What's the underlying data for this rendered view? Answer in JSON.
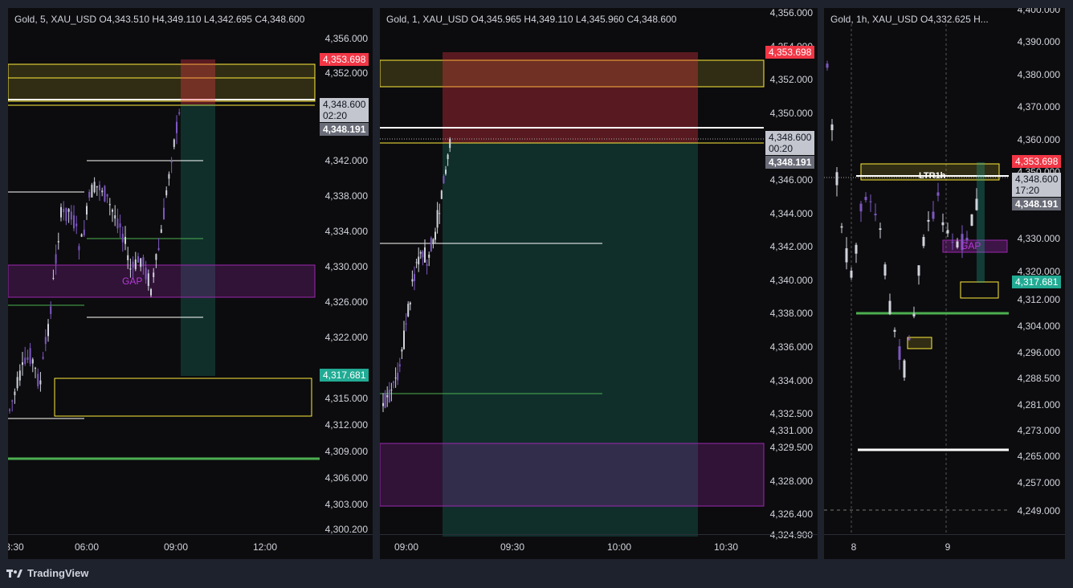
{
  "panes": [
    {
      "legend": "Gold, 5, XAU_USD  O4,343.510  H4,349.110  L4,342.695  C4,348.600",
      "price_ticks": [
        "4,356.000",
        "4,352.000",
        "4,342.000",
        "4,338.000",
        "4,334.000",
        "4,330.000",
        "4,326.000",
        "4,322.000",
        "4,315.000",
        "4,312.000",
        "4,309.000",
        "4,306.000",
        "4,303.000",
        "4,300.200"
      ],
      "time_ticks": [
        "3:30",
        "06:00",
        "09:00",
        "12:00"
      ],
      "tags": {
        "red": "4,353.698",
        "last": "4,348.600",
        "countdown": "02:20",
        "ma": "4,348.191",
        "teal": "4,317.681"
      },
      "gap_label": "GAP"
    },
    {
      "legend": "Gold, 1, XAU_USD  O4,345.965  H4,349.110  L4,345.960  C4,348.600",
      "price_ticks": [
        "4,356.000",
        "4,354.000",
        "4,352.000",
        "4,350.000",
        "4,346.000",
        "4,344.000",
        "4,342.000",
        "4,340.000",
        "4,338.000",
        "4,336.000",
        "4,334.000",
        "4,332.500",
        "4,331.000",
        "4,329.500",
        "4,328.000",
        "4,326.400",
        "4,324.900"
      ],
      "time_ticks": [
        "09:00",
        "09:30",
        "10:00",
        "10:30"
      ],
      "tags": {
        "red": "4,353.698",
        "last": "4,348.600",
        "countdown": "00:20",
        "ma": "4,348.191"
      }
    },
    {
      "legend": "Gold, 1h, XAU_USD  O4,332.625  H...",
      "price_ticks": [
        "4,400.000",
        "4,390.000",
        "4,380.000",
        "4,370.000",
        "4,360.000",
        "4,350.000",
        "4,330.000",
        "4,320.000",
        "4,312.000",
        "4,304.000",
        "4,296.000",
        "4,288.500",
        "4,281.000",
        "4,273.000",
        "4,265.000",
        "4,257.000",
        "4,249.000"
      ],
      "time_ticks": [
        "8",
        "9"
      ],
      "tags": {
        "red": "4,353.698",
        "last": "4,348.600",
        "countdown": "17:20",
        "ma": "4,348.191",
        "teal": "4,317.681"
      },
      "gap_label": "GAP",
      "ltr_label": "LTR1h"
    }
  ],
  "footer": {
    "brand": "TradingView"
  },
  "colors": {
    "background": "#0c0c0e",
    "up": "#d1d4dc",
    "down": "#7e57c2",
    "zone_yellow": "#ffeb3b",
    "zone_purple": "#9c27b0",
    "zone_red": "#f23645",
    "zone_teal": "#22ab94",
    "level_green": "#4caf50"
  }
}
